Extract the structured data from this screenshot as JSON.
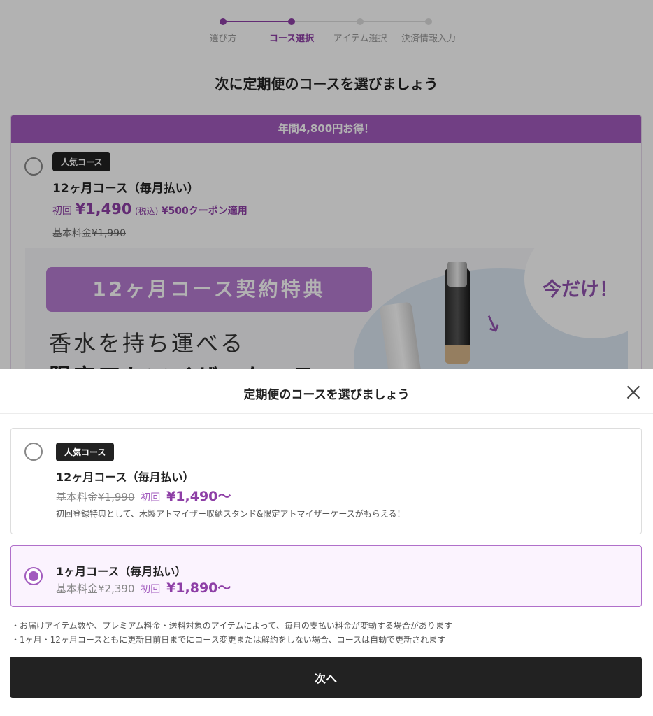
{
  "stepper": {
    "steps": [
      "選び方",
      "コース選択",
      "アイテム選択",
      "決済情報入力"
    ],
    "active_index": 1
  },
  "background": {
    "title": "次に定期便のコースを選びましょう",
    "banner": "年間4,800円お得！",
    "badge": "人気コース",
    "course_name": "12ヶ月コース（毎月払い）",
    "first_label": "初回",
    "first_price": "¥1,490",
    "tax_note": "(税込)",
    "coupon": "¥500クーポン適用",
    "base_label": "基本料金",
    "base_price": "¥1,990",
    "promo": {
      "pill": "12ヶ月コース契約特典",
      "now": "今だけ！",
      "line1": "香水を持ち運べる",
      "line2": "限定アトマイザーケース"
    }
  },
  "sheet": {
    "title": "定期便のコースを選びましょう",
    "options": [
      {
        "badge": "人気コース",
        "name": "12ヶ月コース（毎月払い）",
        "base_label": "基本料金",
        "base_price": "¥1,990",
        "first_label": "初回",
        "first_price": "¥1,490〜",
        "note": "初回登録特典として、木製アトマイザー収納スタンド&限定アトマイザーケースがもらえる！",
        "selected": false
      },
      {
        "name": "1ヶ月コース（毎月払い）",
        "base_label": "基本料金",
        "base_price": "¥2,390",
        "first_label": "初回",
        "first_price": "¥1,890〜",
        "selected": true
      }
    ],
    "notes": [
      "・お届けアイテム数や、プレミアム料金・送料対象のアイテムによって、毎月の支払い料金が変動する場合があります",
      "・1ヶ月・12ヶ月コースともに更新日前日までにコース変更または解約をしない場合、コースは自動で更新されます"
    ],
    "next_label": "次へ"
  },
  "colors": {
    "accent": "#8e3fa6",
    "accent_light": "#fbf3fe",
    "button": "#222222"
  }
}
